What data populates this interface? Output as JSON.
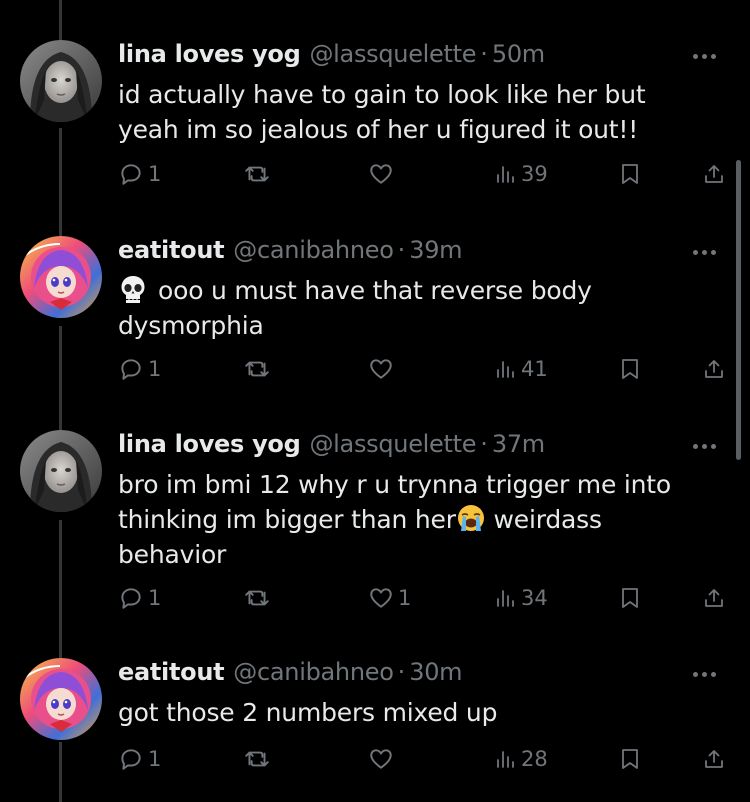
{
  "tweets": [
    {
      "name": "lina loves yog",
      "handle": "@lassquelette",
      "time": "50m",
      "text_lines": [
        "id actually have to gain to look like her but",
        "yeah im so jealous of her u figured it out!!"
      ],
      "replies": "1",
      "likes": "",
      "views": "39",
      "avatar": "girl-photo-avatar"
    },
    {
      "name": "eatitout",
      "handle": "@canibahneo",
      "time": "39m",
      "text_line1_emoji": "skull-emoji",
      "text_line1": "ooo u must have that reverse body",
      "text_line2": "dysmorphia",
      "replies": "1",
      "likes": "",
      "views": "41",
      "avatar": "anime-character-avatar"
    },
    {
      "name": "lina loves yog",
      "handle": "@lassquelette",
      "time": "37m",
      "text_line1": "bro im bmi 12 why r u trynna trigger me into",
      "text_line2_before": "thinking im bigger than her",
      "text_line2_emoji": "loudly-crying-face-emoji",
      "text_line2_after": " weirdass",
      "text_line3": "behavior",
      "replies": "1",
      "likes": "1",
      "views": "34",
      "avatar": "girl-photo-avatar"
    },
    {
      "name": "eatitout",
      "handle": "@canibahneo",
      "time": "30m",
      "text_lines": [
        "got those 2 numbers mixed up"
      ],
      "replies": "1",
      "likes": "",
      "views": "28",
      "avatar": "anime-character-avatar"
    }
  ],
  "separator": "·",
  "colors": {
    "background": "#000000",
    "text": "#e7e9ea",
    "muted": "#71767b",
    "thread_line": "#333639"
  }
}
